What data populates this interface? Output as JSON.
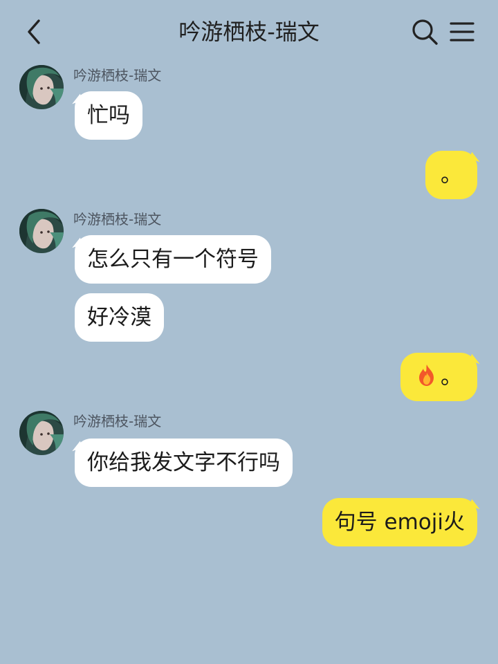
{
  "header": {
    "title": "吟游栖枝-瑞文",
    "back_icon": "chevron-left-icon",
    "search_icon": "search-icon",
    "menu_icon": "menu-icon"
  },
  "colors": {
    "background": "#a9bfd1",
    "incoming_bubble": "#ffffff",
    "outgoing_bubble": "#fbe83a"
  },
  "messages": [
    {
      "sender": "吟游栖枝-瑞文",
      "direction": "incoming",
      "text": "忙吗"
    },
    {
      "direction": "outgoing",
      "text": "。"
    },
    {
      "sender": "吟游栖枝-瑞文",
      "direction": "incoming",
      "text": "怎么只有一个符号"
    },
    {
      "direction": "incoming",
      "text": "好冷漠"
    },
    {
      "direction": "outgoing",
      "emoji": "fire-emoji",
      "text": "。"
    },
    {
      "sender": "吟游栖枝-瑞文",
      "direction": "incoming",
      "text": "你给我发文字不行吗"
    },
    {
      "direction": "outgoing",
      "text": "句号 emoji火"
    }
  ]
}
